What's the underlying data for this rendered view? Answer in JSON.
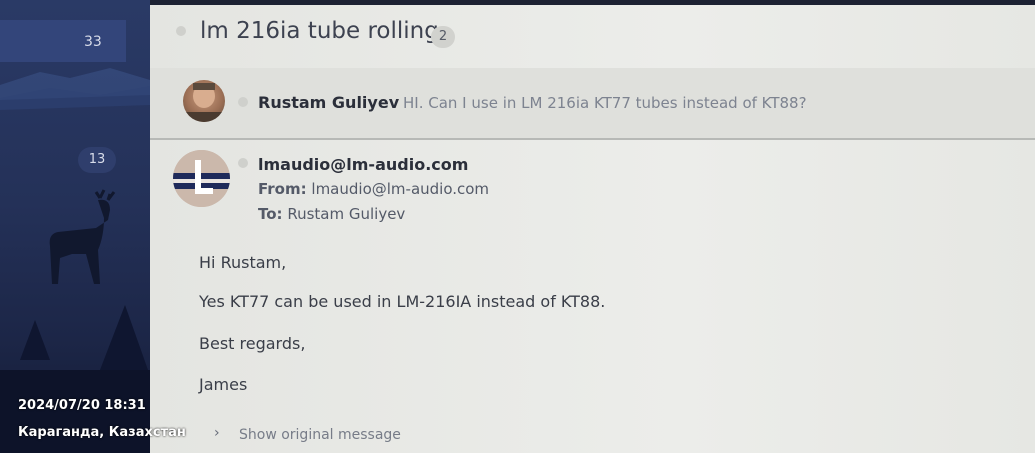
{
  "sidebar": {
    "counts": [
      "33",
      "13"
    ]
  },
  "thread": {
    "subject": "lm 216ia tube rolling",
    "message_count": "2"
  },
  "message1": {
    "sender": "Rustam Guliyev",
    "snippet": "HI. Can I use in LM 216ia KT77 tubes instead of KT88?"
  },
  "message2": {
    "sender": "lmaudio@lm-audio.com",
    "from_label": "From:",
    "from_value": "lmaudio@lm-audio.com",
    "to_label": "To:",
    "to_value": "Rustam Guliyev",
    "body": [
      "Hi Rustam,",
      "Yes KT77 can be used in LM-216IA instead of KT88.",
      "Best regards,",
      "James"
    ],
    "show_original": "Show original message"
  },
  "overlay": {
    "datetime": "2024/07/20 18:31",
    "location": "Караганда, Казахстан"
  },
  "colors": {
    "sidebar": "#243158",
    "accent_navy": "#1f2a5a",
    "text": "#3a3e48"
  },
  "icons": {
    "chevron": "chevron-right-icon",
    "unread_dot": "dot-icon"
  }
}
